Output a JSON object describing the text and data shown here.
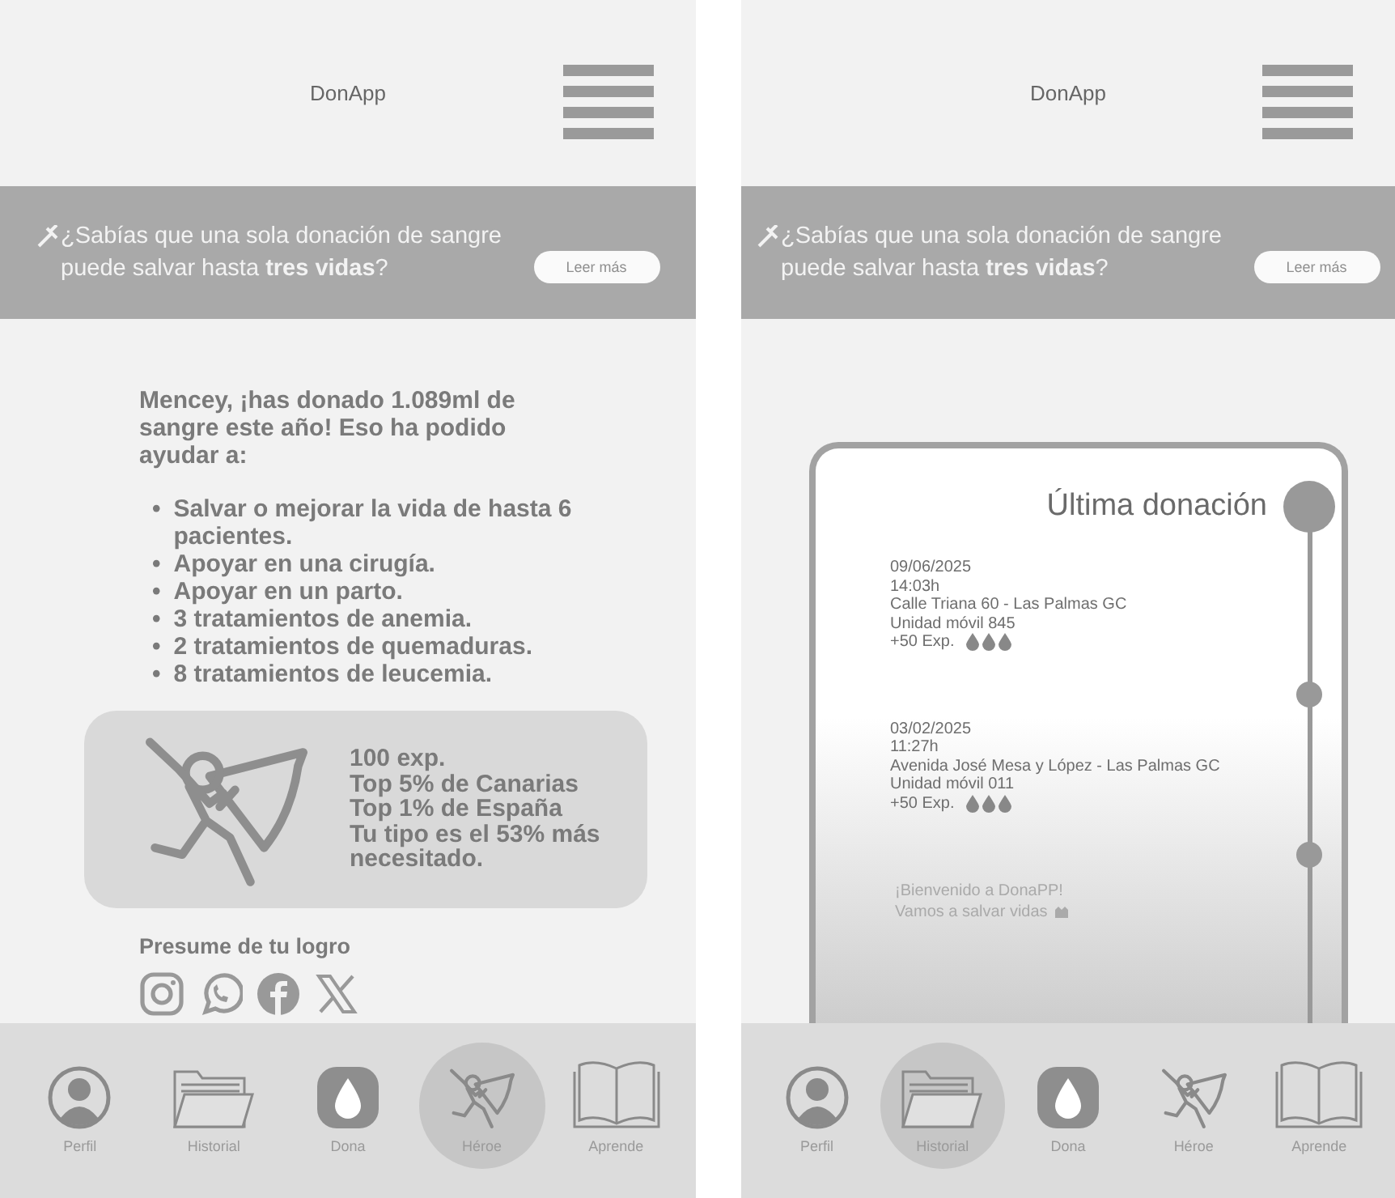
{
  "screens": [
    {
      "title": "DonApp",
      "banner": {
        "text": "¿Sabías que una sola donación de sangre puede salvar hasta **tres vidas**?",
        "button": "Leer más"
      },
      "content": {
        "kind": "impact",
        "bullet": "•",
        "summary": "Mencey, ¡has donado 1.089ml de sangre este año! Eso ha podido ayudar a:",
        "benefits": [
          "Salvar o mejorar la vida de hasta 6 pacientes.",
          "Apoyar en una cirugía.",
          "Apoyar en un parto.",
          "3 tratamientos de anemia.",
          "2 tratamientos de quemaduras.",
          "8 tratamientos de leucemia."
        ],
        "stats": [
          "100 exp.",
          "Top 5% de Canarias",
          "Top 1% de España",
          "Tu tipo es el 53% más necesitado."
        ],
        "share_label": "Presume de tu logro"
      },
      "nav": [
        {
          "label": "Perfil",
          "selected": false
        },
        {
          "label": "Historial",
          "selected": false
        },
        {
          "label": "Dona",
          "selected": false
        },
        {
          "label": "Héroe",
          "selected": true
        },
        {
          "label": "Aprende",
          "selected": false
        }
      ]
    },
    {
      "title": "DonApp",
      "banner": {
        "text": "¿Sabías que una sola donación de sangre puede salvar hasta **tres vidas**?",
        "button": "Leer más"
      },
      "content": {
        "kind": "history",
        "title": "Última donación",
        "entries": [
          {
            "kind": "donation",
            "lines": [
              "09/06/2025",
              "14:03h",
              "Calle Triana 60 - Las Palmas GC",
              "Unidad móvil 845"
            ],
            "exp": "+50 Exp."
          },
          {
            "kind": "donation",
            "lines": [
              "03/02/2025",
              "11:27h",
              "Avenida José Mesa y López - Las Palmas GC",
              "Unidad móvil 011"
            ],
            "exp": "+50 Exp."
          },
          {
            "kind": "welcome",
            "lines": [
              "¡Bienvenido a DonaPP!",
              "Vamos a salvar vidas"
            ]
          }
        ]
      },
      "nav": [
        {
          "label": "Perfil",
          "selected": false
        },
        {
          "label": "Historial",
          "selected": true
        },
        {
          "label": "Dona",
          "selected": false
        },
        {
          "label": "Héroe",
          "selected": false
        },
        {
          "label": "Aprende",
          "selected": false
        }
      ]
    }
  ]
}
